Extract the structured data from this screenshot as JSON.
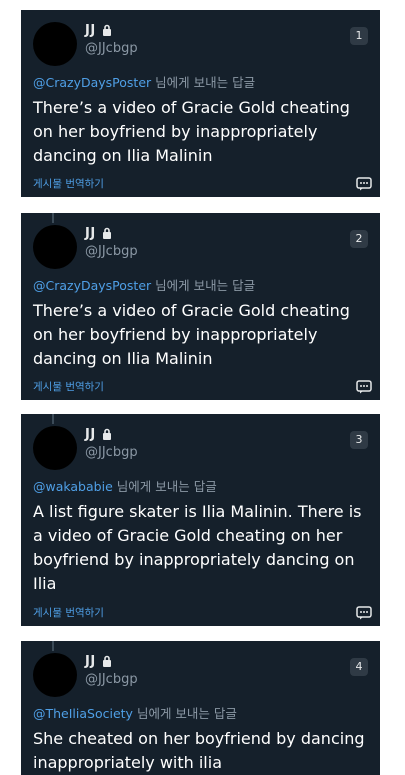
{
  "reply_prefix": "님에게 보내는 답글",
  "translate_label": "게시물 번역하기",
  "tweets": [
    {
      "name": "JJ",
      "handle": "@JJcbgp",
      "index": "1",
      "mention": "@CrazyDaysPoster",
      "text": "There’s a video of Gracie Gold cheating on her boyfriend by inappropriately dancing on Ilia Malinin"
    },
    {
      "name": "JJ",
      "handle": "@JJcbgp",
      "index": "2",
      "mention": "@CrazyDaysPoster",
      "text": "There’s a video of Gracie Gold cheating on her boyfriend by inappropriately dancing on Ilia Malinin"
    },
    {
      "name": "JJ",
      "handle": "@JJcbgp",
      "index": "3",
      "mention": "@wakababie",
      "text": "A list figure skater is Ilia Malinin. There is a video of Gracie Gold cheating on her boyfriend by inappropriately dancing on Ilia"
    },
    {
      "name": "JJ",
      "handle": "@JJcbgp",
      "index": "4",
      "mention": "@TheIliaSociety",
      "text": "She cheated on her boyfriend by dancing inappropriately with ilia"
    }
  ]
}
